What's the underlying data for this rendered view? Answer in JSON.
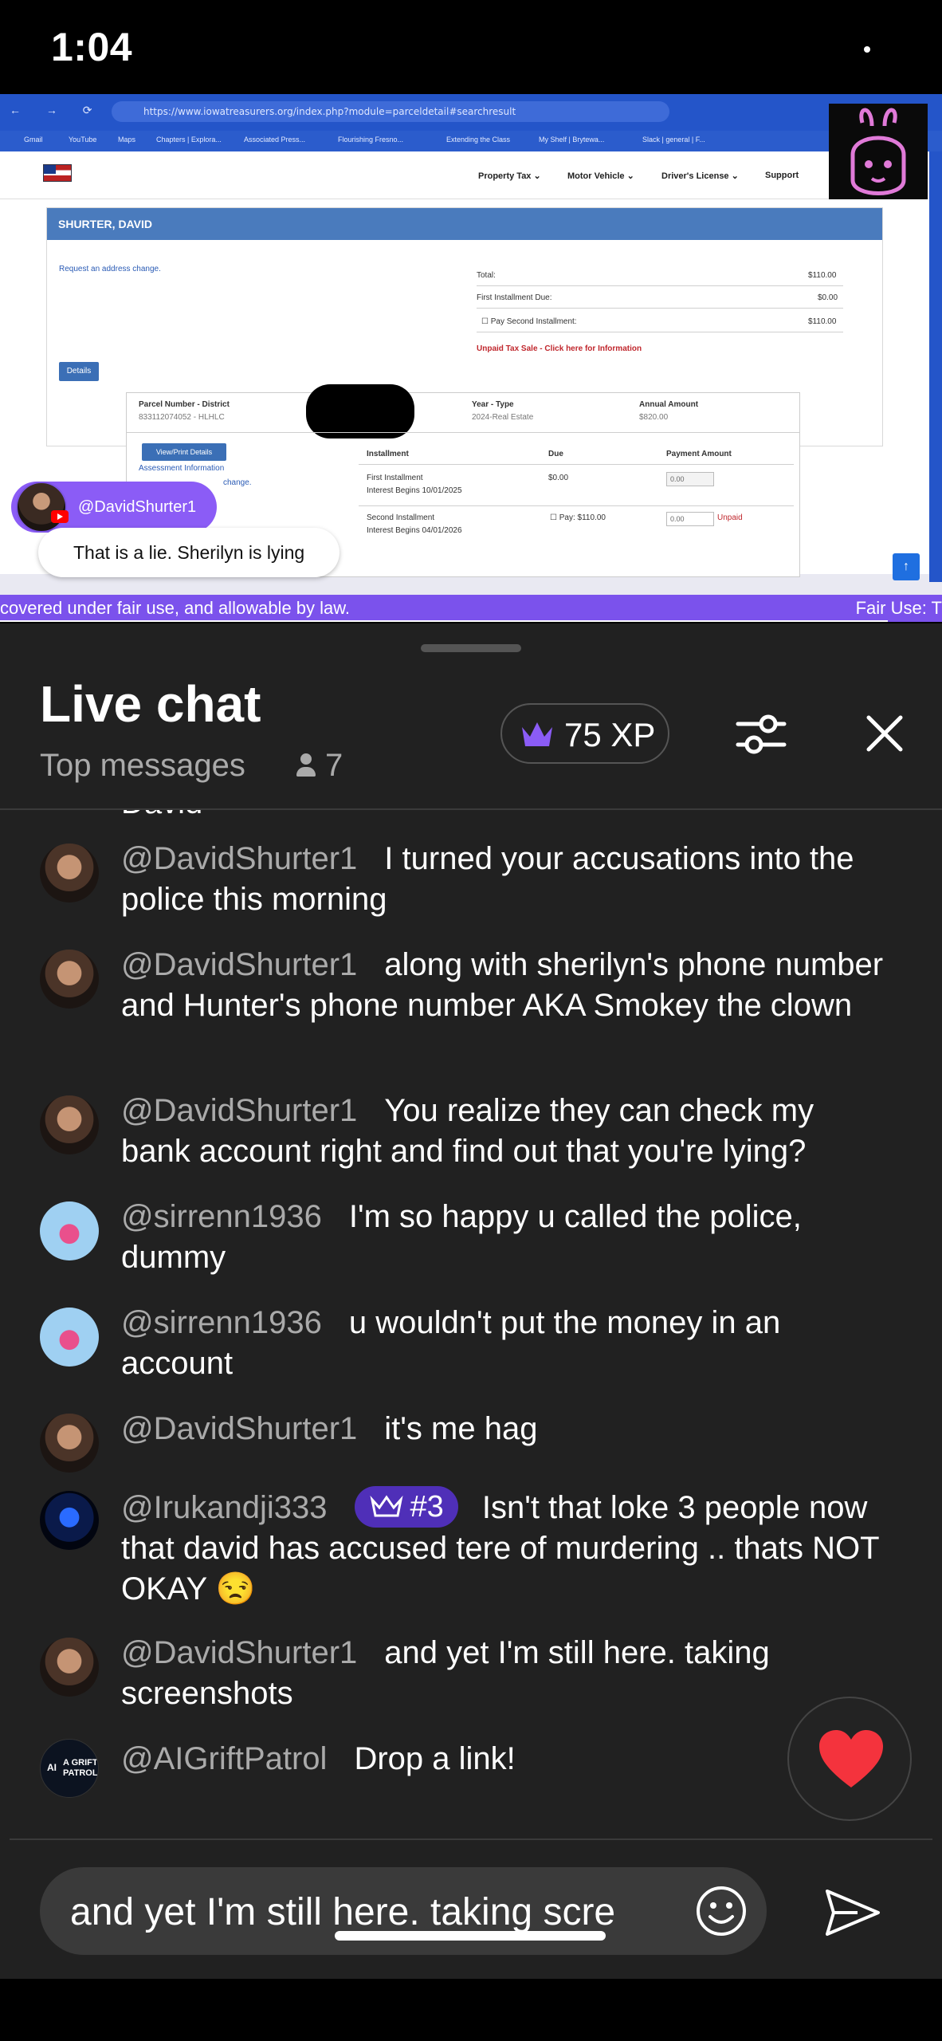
{
  "status_bar": {
    "time": "1:04"
  },
  "video": {
    "browser": {
      "url": "https://www.iowatreasurers.org/index.php?module=parceldetail#searchresult",
      "bookmarks": [
        "Gmail",
        "YouTube",
        "Maps",
        "Chapters | Explora...",
        "Associated Press...",
        "Flourishing Fresno...",
        "Extending the Class",
        "My Shelf | Brytewa...",
        "Slack | general | F..."
      ]
    },
    "site": {
      "nav": [
        "Property Tax ⌄",
        "Motor Vehicle ⌄",
        "Driver's License ⌄",
        "Support"
      ],
      "card_title": "SHURTER, DAVID",
      "address_link": "Request an address change.",
      "total_label": "Total:",
      "total_value": "$110.00",
      "first_due_label": "First Installment Due:",
      "first_due_value": "$0.00",
      "pay_second_label": "Pay Second Installment:",
      "pay_second_value": "$110.00",
      "unpaid_notice": "Unpaid Tax Sale - Click here for Information",
      "details_button": "Details",
      "parcel_header": "Parcel Number - District",
      "parcel_value": "833112074052 - HLHLC",
      "year_header": "Year - Type",
      "year_value": "2024-Real Estate",
      "annual_header": "Annual Amount",
      "annual_value": "$820.00",
      "view_print": "View/Print Details",
      "assessment_link": "Assessment Information",
      "change_link": "change.",
      "col_installment": "Installment",
      "col_due": "Due",
      "col_payment": "Payment Amount",
      "first_installment": "First Installment",
      "first_interest": "Interest Begins 10/01/2025",
      "first_due": "$0.00",
      "first_payment": "0.00",
      "second_installment": "Second Installment",
      "second_interest": "Interest Begins 04/01/2026",
      "second_pay": "Pay: $110.00",
      "second_payment": "0.00",
      "unpaid": "Unpaid"
    },
    "overlay": {
      "chip_name": "@DavidShurter1",
      "bubble_text": "That is a lie. Sherilyn is lying"
    },
    "ticker_left": "covered under fair use, and allowable by law.",
    "ticker_right": "Fair Use: T"
  },
  "chat": {
    "title": "Live chat",
    "mode": "Top messages",
    "viewer_count": "7",
    "xp": "75 XP",
    "cutoff_text": "David",
    "messages": [
      {
        "author": "@DavidShurter1",
        "text": "I turned your accusations into the police this morning",
        "avatar": "david"
      },
      {
        "author": "@DavidShurter1",
        "text": "along with sherilyn's phone number and Hunter's phone number AKA Smokey the clown",
        "avatar": "david"
      },
      {
        "author": "@DavidShurter1",
        "text": "You realize they can check my bank account right and find out that you're lying?",
        "avatar": "david"
      },
      {
        "author": "@sirrenn1936",
        "text": "I'm so happy u called the police, dummy",
        "avatar": "sirren"
      },
      {
        "author": "@sirrenn1936",
        "text": "u wouldn't put the money in an account",
        "avatar": "sirren"
      },
      {
        "author": "@DavidShurter1",
        "text": "it's me hag",
        "avatar": "david"
      },
      {
        "author": "@Irukandji333",
        "badge": "#3",
        "text": "Isn't that loke 3 people now that david has accused tere of murdering .. thats NOT OKAY 😒",
        "avatar": "iruk"
      },
      {
        "author": "@DavidShurter1",
        "text": "and yet I'm still here. taking screenshots",
        "avatar": "david"
      },
      {
        "author": "@AIGriftPatrol",
        "text": "Drop a link!",
        "avatar": "ai"
      }
    ],
    "ai_avatar_text": {
      "ai": "AI",
      "line1": "A GRIFT",
      "line2": "PATROL"
    },
    "input_value": "and yet I'm still here. taking scre",
    "colors": {
      "accent": "#8b5cf6",
      "background": "#212121",
      "author": "#aaaaaa"
    }
  }
}
